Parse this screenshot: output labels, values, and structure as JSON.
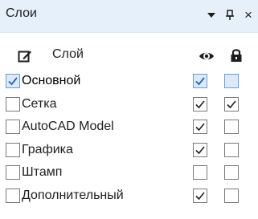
{
  "panel": {
    "title": "Слои",
    "dropdown_icon": "triangle-down-icon",
    "pin_icon": "pin-icon",
    "close_label": "×"
  },
  "header": {
    "edit_icon": "edit-pencil-icon",
    "layer_column": "Слой",
    "visibility_icon": "eye-icon",
    "lock_icon": "lock-icon"
  },
  "layers": [
    {
      "name": "Основной",
      "checked": true,
      "visible": true,
      "locked": false,
      "selected": true
    },
    {
      "name": "Сетка",
      "checked": false,
      "visible": true,
      "locked": true,
      "selected": false
    },
    {
      "name": "AutoCAD Model",
      "checked": false,
      "visible": true,
      "locked": false,
      "selected": false
    },
    {
      "name": "Графика",
      "checked": false,
      "visible": true,
      "locked": false,
      "selected": false
    },
    {
      "name": "Штамп",
      "checked": false,
      "visible": false,
      "locked": false,
      "selected": false
    },
    {
      "name": "Дополнительный",
      "checked": false,
      "visible": true,
      "locked": false,
      "selected": false
    }
  ],
  "colors": {
    "titlebar_bg": "#e6f0fa",
    "selection_checkbox_bg": "#dbe9f9",
    "selection_checkbox_border": "#6c9bd6",
    "check_blue": "#2b63b8",
    "check_dark": "#222222"
  }
}
